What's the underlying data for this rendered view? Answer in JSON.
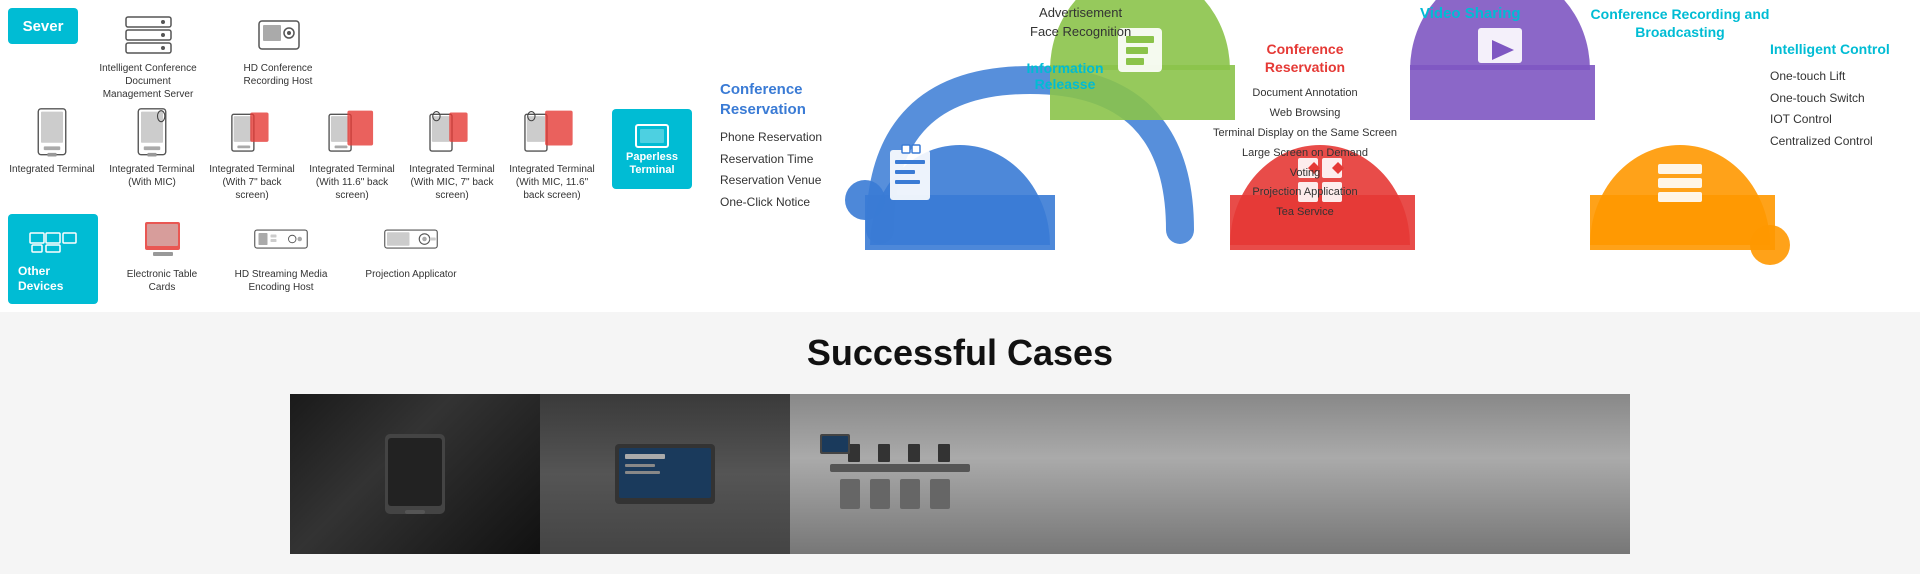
{
  "header": {
    "server_label": "Sever"
  },
  "server_items": [
    {
      "label": "Intelligent Conference Document Management Server",
      "icon_type": "server"
    },
    {
      "label": "HD Conference Recording Host",
      "icon_type": "host"
    }
  ],
  "terminals": [
    {
      "label": "Integrated Terminal",
      "icon_type": "terminal_slim"
    },
    {
      "label": "Integrated Terminal (With MIC)",
      "icon_type": "terminal_mic"
    },
    {
      "label": "Integrated Terminal (With 7\" back screen)",
      "icon_type": "terminal_7back"
    },
    {
      "label": "Integrated Terminal (With 11.6\" back screen)",
      "icon_type": "terminal_11back"
    },
    {
      "label": "Integrated Terminal (With MIC, 7\" back screen)",
      "icon_type": "terminal_mic7"
    },
    {
      "label": "Integrated Terminal (With MIC, 11.6\" back screen)",
      "icon_type": "terminal_mic11"
    },
    {
      "label": "Paperless Terminal",
      "icon_type": "paperless",
      "highlight": true
    }
  ],
  "other_devices": {
    "label": "Other Devices",
    "items": [
      {
        "label": "Electronic Table Cards",
        "icon_type": "table_card"
      },
      {
        "label": "HD Streaming Media Encoding Host",
        "icon_type": "stream_host"
      },
      {
        "label": "Projection Applicator",
        "icon_type": "projector"
      }
    ]
  },
  "diagram": {
    "conference_reservation": {
      "title": "Conference Reservation",
      "items": [
        "Phone Reservation",
        "Reservation Time",
        "Reservation Venue",
        "One-Click Notice"
      ]
    },
    "information_release": {
      "title": "Information Releasse",
      "color": "#00bcd4"
    },
    "advertisement": "Advertisement",
    "face_recognition": "Face Recognition",
    "conference_reservation_right": {
      "title": "Conference\nReservation",
      "items": [
        "Document Annotation",
        "Web Browsing",
        "Terminal Display on the Same Screen",
        "Large Screen on Demand",
        "Voting",
        "Projection Application",
        "Tea Service"
      ]
    },
    "video_sharing": {
      "title": "Video Sharing",
      "color": "#00bcd4"
    },
    "conference_recording": {
      "title": "Conference Recording and Broadcasting",
      "color": "#00bcd4"
    },
    "intelligent_control": {
      "title": "Intelligent Control",
      "color": "#00bcd4",
      "items": [
        "One-touch Lift",
        "One-touch Switch",
        "IOT Control",
        "Centralized Control"
      ]
    }
  },
  "successful_cases": {
    "title": "Successful Cases"
  }
}
